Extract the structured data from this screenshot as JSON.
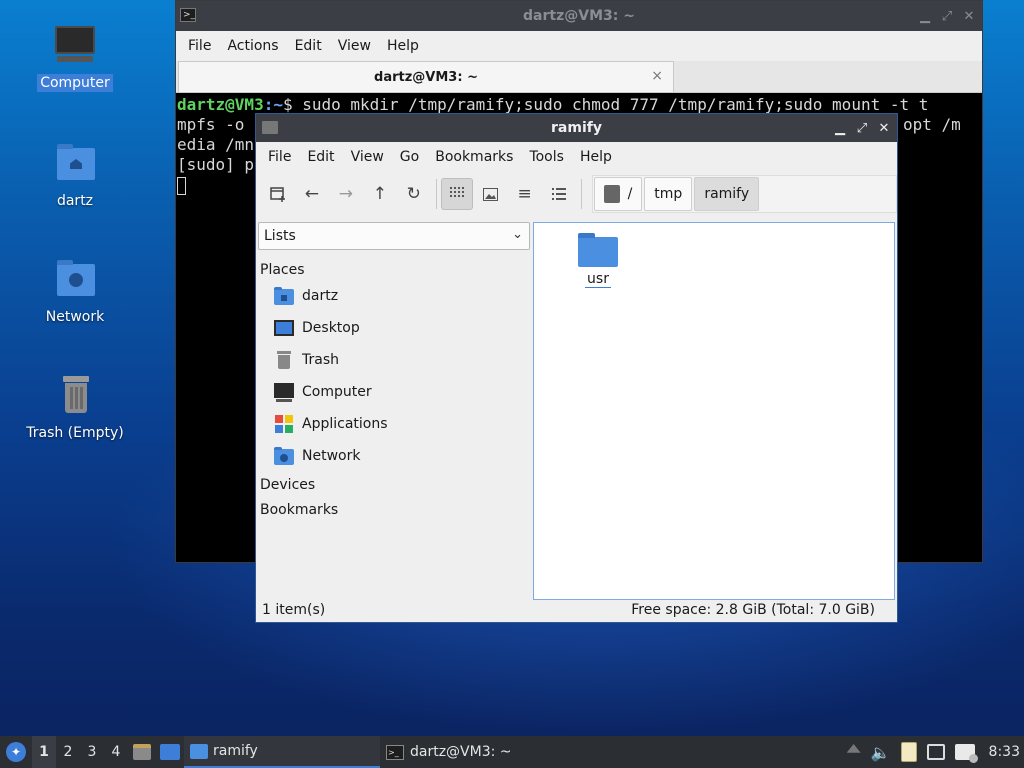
{
  "desktop": {
    "icons": [
      {
        "label": "Computer",
        "icon": "computer-icon"
      },
      {
        "label": "dartz",
        "icon": "home-folder-icon"
      },
      {
        "label": "Network",
        "icon": "network-folder-icon"
      },
      {
        "label": "Trash (Empty)",
        "icon": "trash-icon"
      }
    ]
  },
  "terminal": {
    "title": "dartz@VM3: ~",
    "menu": [
      "File",
      "Actions",
      "Edit",
      "View",
      "Help"
    ],
    "tab_label": "dartz@VM3: ~",
    "tab_close": "×",
    "prompt_user": "dartz@VM3",
    "prompt_path": ":~",
    "prompt_symbol": "$",
    "command": " sudo mkdir /tmp/ramify;sudo chmod 777 /tmp/ramify;sudo mount -t t",
    "line2_left": "mpfs -o ",
    "line2_right": "opt /m",
    "line3": "edia /mn",
    "line4": "[sudo] p"
  },
  "file_manager": {
    "title": "ramify",
    "menu": [
      "File",
      "Edit",
      "View",
      "Go",
      "Bookmarks",
      "Tools",
      "Help"
    ],
    "path": [
      "/",
      "tmp",
      "ramify"
    ],
    "sidebar_mode": "Lists",
    "places_heading": "Places",
    "places": [
      "dartz",
      "Desktop",
      "Trash",
      "Computer",
      "Applications",
      "Network"
    ],
    "devices_heading": "Devices",
    "bookmarks_heading": "Bookmarks",
    "files": [
      {
        "name": "usr",
        "type": "folder"
      }
    ],
    "status_left": "1 item(s)",
    "status_right": "Free space: 2.8 GiB (Total: 7.0 GiB)"
  },
  "taskbar": {
    "workspaces": [
      "1",
      "2",
      "3",
      "4"
    ],
    "tasks": [
      {
        "label": "ramify",
        "icon": "folder-icon"
      },
      {
        "label": "dartz@VM3: ~",
        "icon": "terminal-icon"
      }
    ],
    "clock": "8:33"
  },
  "colors": {
    "accent": "#3d7fd8",
    "titlebar": "#3b3f45",
    "taskbar": "#2b2e33",
    "terminal_prompt": "#5fd35f",
    "terminal_path": "#6aa6ff"
  }
}
